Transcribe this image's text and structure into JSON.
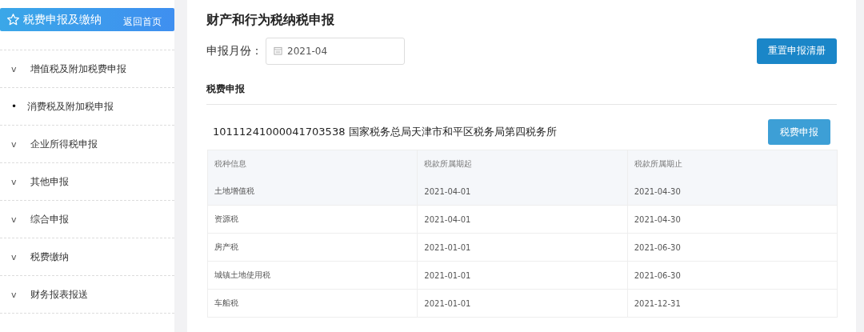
{
  "sidebar": {
    "title": "税费申报及缴纳",
    "home_link": "返回首页",
    "items": [
      {
        "marker": "v",
        "label": "增值税及附加税费申报"
      },
      {
        "marker": "•",
        "label": "消费税及附加税申报"
      },
      {
        "marker": "v",
        "label": "企业所得税申报"
      },
      {
        "marker": "v",
        "label": "其他申报"
      },
      {
        "marker": "v",
        "label": "综合申报"
      },
      {
        "marker": "v",
        "label": "税费缴纳"
      },
      {
        "marker": "v",
        "label": "财务报表报送"
      }
    ]
  },
  "main": {
    "title": "财产和行为税纳税申报",
    "month_label": "申报月份：",
    "month_value": "2021-04",
    "reset_button": "重置申报清册",
    "section_title": "税费申报",
    "office": {
      "name": "10111241000041703538 国家税务总局天津市和平区税务局第四税务所",
      "button": "税费申报"
    },
    "table": {
      "columns": [
        "税种信息",
        "税款所属期起",
        "税款所属期止"
      ],
      "rows": [
        {
          "cells": [
            "土地增值税",
            "2021-04-01",
            "2021-04-30"
          ],
          "highlighted": true
        },
        {
          "cells": [
            "资源税",
            "2021-04-01",
            "2021-04-30"
          ],
          "highlighted": false
        },
        {
          "cells": [
            "房产税",
            "2021-01-01",
            "2021-06-30"
          ],
          "highlighted": false
        },
        {
          "cells": [
            "城镇土地使用税",
            "2021-01-01",
            "2021-06-30"
          ],
          "highlighted": false
        },
        {
          "cells": [
            "车船税",
            "2021-01-01",
            "2021-12-31"
          ],
          "highlighted": false
        }
      ]
    }
  }
}
